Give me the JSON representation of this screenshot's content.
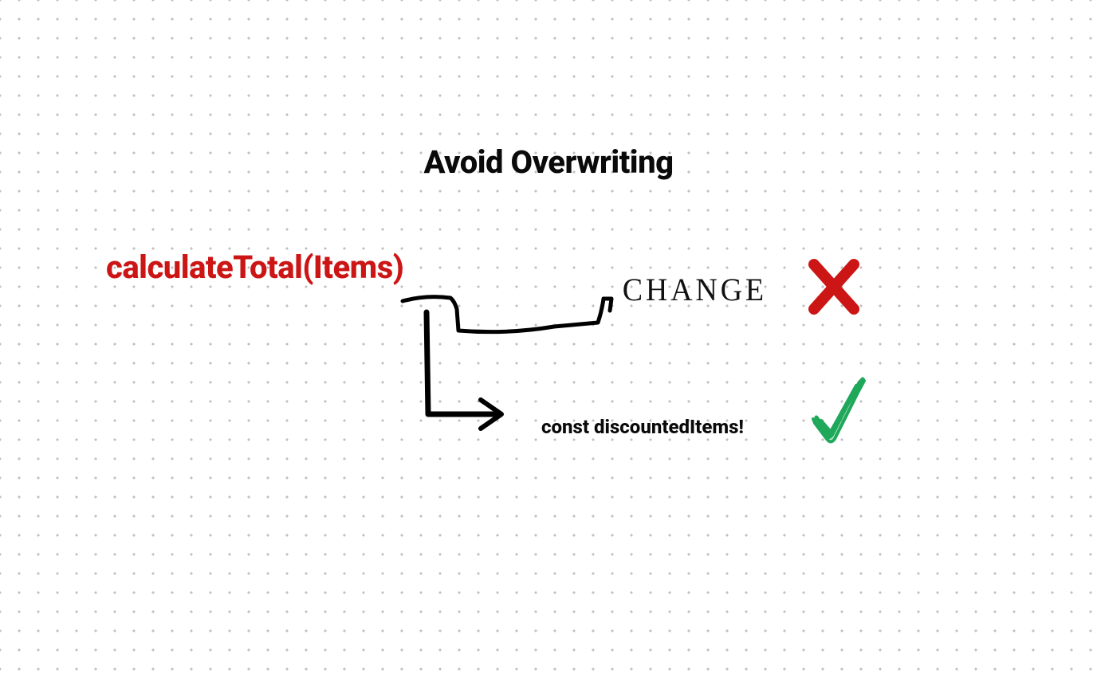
{
  "title": "Avoid Overwriting",
  "function_expression": "calculateTotal(Items)",
  "change_label": "CHANGE",
  "const_expression": "const discountedItems!",
  "colors": {
    "title": "#0a0a0a",
    "function": "#cc1515",
    "x_mark": "#cc1515",
    "check_mark": "#1fa85a",
    "text": "#0a0a0a"
  }
}
